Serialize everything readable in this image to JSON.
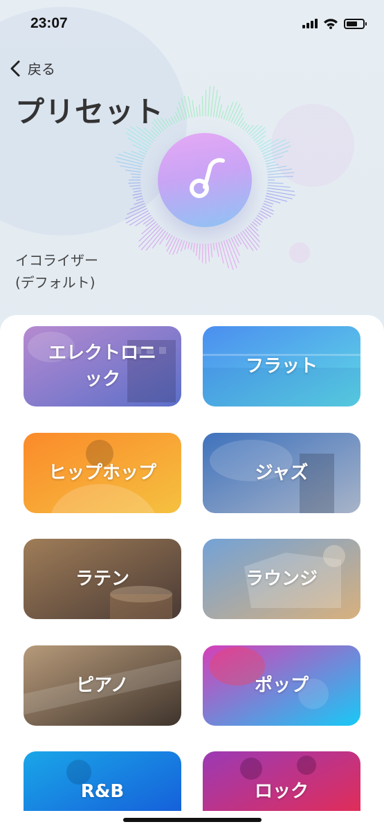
{
  "status_bar": {
    "time": "23:07",
    "battery_level": 0.7,
    "signal_icon": "cellular-signal-icon",
    "wifi_icon": "wifi-icon",
    "battery_icon": "battery-icon"
  },
  "header": {
    "back_label": "戻る",
    "back_icon": "chevron-left-icon",
    "title": "プリセット",
    "current_preset_line1": "イコライザー",
    "current_preset_line2": "(デフォルト)",
    "music_icon": "music-note-icon"
  },
  "presets": [
    {
      "label": "エレクトロニック",
      "colors": [
        "#b68ad0",
        "#5b6fc9"
      ]
    },
    {
      "label": "フラット",
      "colors": [
        "#4b8ef0",
        "#5fd8e4"
      ]
    },
    {
      "label": "ヒップホップ",
      "colors": [
        "#fb8a2a",
        "#f5c140"
      ]
    },
    {
      "label": "ジャズ",
      "colors": [
        "#3f72bd",
        "#a8b4c8"
      ]
    },
    {
      "label": "ラテン",
      "colors": [
        "#9f7d58",
        "#4a3a35"
      ]
    },
    {
      "label": "ラウンジ",
      "colors": [
        "#73a2d6",
        "#d8b07d"
      ]
    },
    {
      "label": "ピアノ",
      "colors": [
        "#b79a7a",
        "#3f342c"
      ]
    },
    {
      "label": "ポップ",
      "colors": [
        "#d63fb7",
        "#18c9f6"
      ]
    },
    {
      "label": "R&B",
      "colors": [
        "#1aa6e8",
        "#1556d8"
      ]
    },
    {
      "label": "ロック",
      "colors": [
        "#9b3ab5",
        "#ea2b4c"
      ]
    }
  ]
}
